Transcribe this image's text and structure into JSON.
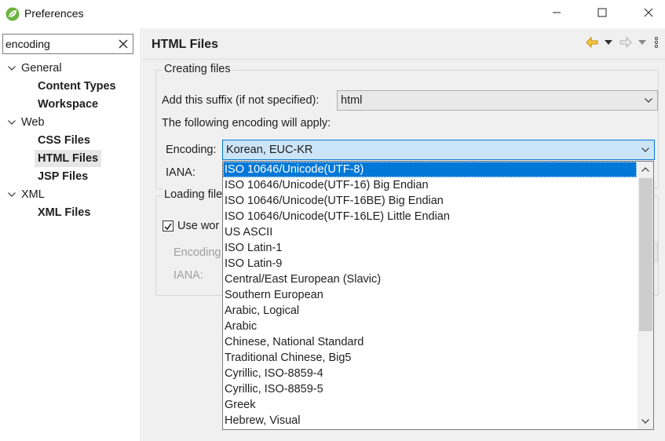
{
  "window": {
    "title": "Preferences",
    "app_icon": "eclipse-spring-leaf-icon",
    "controls": [
      "minimize-icon",
      "maximize-icon",
      "close-icon"
    ]
  },
  "sidebar": {
    "filter": {
      "value": "encoding",
      "clear_icon": "clear-x-icon"
    },
    "tree": [
      {
        "label": "General",
        "expanded": true,
        "level": 0
      },
      {
        "label": "Content Types",
        "level": 1
      },
      {
        "label": "Workspace",
        "level": 1
      },
      {
        "label": "Web",
        "expanded": true,
        "level": 0
      },
      {
        "label": "CSS Files",
        "level": 1
      },
      {
        "label": "HTML Files",
        "level": 1,
        "selected": true
      },
      {
        "label": "JSP Files",
        "level": 1
      },
      {
        "label": "XML",
        "expanded": true,
        "level": 0
      },
      {
        "label": "XML Files",
        "level": 1
      }
    ]
  },
  "page": {
    "title": "HTML Files",
    "nav_icons": [
      "back-arrow-icon",
      "chevron-down-icon",
      "forward-arrow-icon",
      "chevron-down-icon",
      "view-menu-icon"
    ],
    "creating_group": {
      "title": "Creating files",
      "suffix_label": "Add this suffix (if not specified):",
      "suffix_value": "html",
      "encoding_note": "The following encoding will apply:",
      "encoding_label": "Encoding:",
      "encoding_value": "Korean, EUC-KR",
      "iana_label": "IANA:"
    },
    "loading_group": {
      "title": "Loading file",
      "checkbox_label": "Use wor",
      "checkbox_checked": true,
      "encoding_label": "Encoding",
      "iana_label": "IANA:"
    }
  },
  "encoding_dropdown": {
    "selected_index": 0,
    "items": [
      "ISO 10646/Unicode(UTF-8)",
      "ISO 10646/Unicode(UTF-16) Big Endian",
      "ISO 10646/Unicode(UTF-16BE) Big Endian",
      "ISO 10646/Unicode(UTF-16LE) Little Endian",
      "US ASCII",
      "ISO Latin-1",
      "ISO Latin-9",
      "Central/East European (Slavic)",
      "Southern European",
      "Arabic, Logical",
      "Arabic",
      "Chinese, National Standard",
      "Traditional Chinese, Big5",
      "Cyrillic, ISO-8859-4",
      "Cyrillic, ISO-8859-5",
      "Greek",
      "Hebrew, Visual"
    ]
  },
  "colors": {
    "accent": "#0078d7",
    "focus_fill": "#cce4f7",
    "panel_bg": "#f0f0f0",
    "tree_selection": "#e6e6e6",
    "nav_back": "#e8a200"
  }
}
